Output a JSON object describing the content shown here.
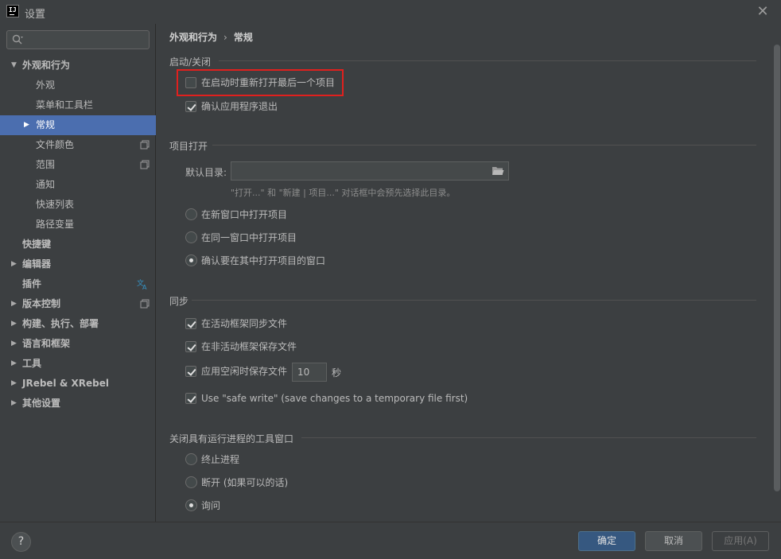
{
  "window": {
    "title": "设置",
    "close_glyph": "✕"
  },
  "search": {
    "value": "",
    "placeholder": ""
  },
  "sidebar": {
    "items": [
      {
        "label": "外观和行为",
        "arrow": "▼"
      },
      {
        "label": "外观"
      },
      {
        "label": "菜单和工具栏"
      },
      {
        "label": "常规",
        "arrow": "▶"
      },
      {
        "label": "文件颜色"
      },
      {
        "label": "范围"
      },
      {
        "label": "通知"
      },
      {
        "label": "快速列表"
      },
      {
        "label": "路径变量"
      },
      {
        "label": "快捷键"
      },
      {
        "label": "编辑器",
        "arrow": "▶"
      },
      {
        "label": "插件"
      },
      {
        "label": "版本控制",
        "arrow": "▶"
      },
      {
        "label": "构建、执行、部署",
        "arrow": "▶"
      },
      {
        "label": "语言和框架",
        "arrow": "▶"
      },
      {
        "label": "工具",
        "arrow": "▶"
      },
      {
        "label": "JRebel & XRebel",
        "arrow": "▶"
      },
      {
        "label": "其他设置",
        "arrow": "▶"
      }
    ]
  },
  "breadcrumb": {
    "parent": "外观和行为",
    "separator": "›",
    "current": "常规"
  },
  "startup": {
    "title": "启动/关闭",
    "reopen_last_project": "在启动时重新打开最后一个项目",
    "confirm_exit": "确认应用程序退出"
  },
  "project_open": {
    "title": "项目打开",
    "default_dir_label": "默认目录:",
    "default_dir_value": "",
    "hint": "\"打开...\" 和 \"新建 | 项目...\" 对话框中会预先选择此目录。",
    "options": [
      "在新窗口中打开项目",
      "在同一窗口中打开项目",
      "确认要在其中打开项目的窗口"
    ]
  },
  "sync": {
    "title": "同步",
    "sync_on_activation": "在活动框架同步文件",
    "save_on_deactivation": "在非活动框架保存文件",
    "save_on_idle": "应用空闲时保存文件",
    "idle_seconds": "10",
    "idle_unit": "秒",
    "safe_write": "Use \"safe write\" (save changes to a temporary file first)"
  },
  "tool_window": {
    "title": "关闭具有运行进程的工具窗口",
    "options": [
      "终止进程",
      "断开 (如果可以的话)",
      "询问"
    ]
  },
  "footer": {
    "help": "?",
    "ok": "确定",
    "cancel": "取消",
    "apply": "应用(A)"
  },
  "colors": {
    "selection": "#4b6eaf",
    "ok_button": "#365880",
    "highlight": "#e0201e",
    "translate_icon": "#3592c4"
  }
}
